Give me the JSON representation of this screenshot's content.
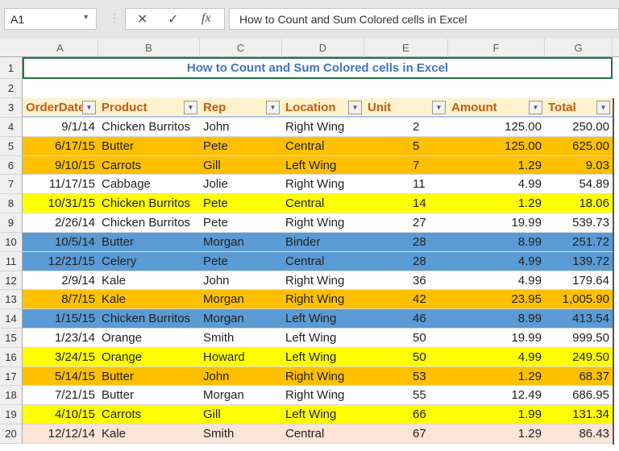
{
  "name_box": "A1",
  "formula_bar": {
    "cancel_icon": "✕",
    "enter_icon": "✓",
    "fx_label": "fx",
    "value": "How to Count and Sum Colored cells in Excel"
  },
  "columns": [
    "A",
    "B",
    "C",
    "D",
    "E",
    "F",
    "G"
  ],
  "title": "How to Count and Sum Colored cells in Excel",
  "headers": [
    "OrderDate",
    "Product",
    "Rep",
    "Location",
    "Unit",
    "Amount",
    "Total"
  ],
  "colors": {
    "orange": "#FFC000",
    "yellow": "#FFFF00",
    "blue": "#5B9BD5",
    "pink": "#FCE4D6",
    "white": "#FFFFFF",
    "header": "#FFF2CC"
  },
  "rows": [
    {
      "n": "4",
      "c": "white",
      "v": [
        "9/1/14",
        "Chicken Burritos",
        "John",
        "Right Wing",
        "2",
        "125.00",
        "250.00"
      ]
    },
    {
      "n": "5",
      "c": "orange",
      "v": [
        "6/17/15",
        "Butter",
        "Pete",
        "Central",
        "5",
        "125.00",
        "625.00"
      ]
    },
    {
      "n": "6",
      "c": "orange",
      "v": [
        "9/10/15",
        "Carrots",
        "Gill",
        "Left Wing",
        "7",
        "1.29",
        "9.03"
      ]
    },
    {
      "n": "7",
      "c": "white",
      "v": [
        "11/17/15",
        "Cabbage",
        "Jolie",
        "Right Wing",
        "11",
        "4.99",
        "54.89"
      ]
    },
    {
      "n": "8",
      "c": "yellow",
      "v": [
        "10/31/15",
        "Chicken Burritos",
        "Pete",
        "Central",
        "14",
        "1.29",
        "18.06"
      ]
    },
    {
      "n": "9",
      "c": "white",
      "v": [
        "2/26/14",
        "Chicken Burritos",
        "Pete",
        "Right Wing",
        "27",
        "19.99",
        "539.73"
      ]
    },
    {
      "n": "10",
      "c": "blue",
      "v": [
        "10/5/14",
        "Butter",
        "Morgan",
        "Binder",
        "28",
        "8.99",
        "251.72"
      ]
    },
    {
      "n": "11",
      "c": "blue",
      "v": [
        "12/21/15",
        "Celery",
        "Pete",
        "Central",
        "28",
        "4.99",
        "139.72"
      ]
    },
    {
      "n": "12",
      "c": "white",
      "v": [
        "2/9/14",
        "Kale",
        "John",
        "Right Wing",
        "36",
        "4.99",
        "179.64"
      ]
    },
    {
      "n": "13",
      "c": "orange",
      "v": [
        "8/7/15",
        "Kale",
        "Morgan",
        "Right Wing",
        "42",
        "23.95",
        "1,005.90"
      ]
    },
    {
      "n": "14",
      "c": "blue",
      "v": [
        "1/15/15",
        "Chicken Burritos",
        "Morgan",
        "Left Wing",
        "46",
        "8.99",
        "413.54"
      ]
    },
    {
      "n": "15",
      "c": "white",
      "v": [
        "1/23/14",
        "Orange",
        "Smith",
        "Left Wing",
        "50",
        "19.99",
        "999.50"
      ]
    },
    {
      "n": "16",
      "c": "yellow",
      "v": [
        "3/24/15",
        "Orange",
        "Howard",
        "Left Wing",
        "50",
        "4.99",
        "249.50"
      ]
    },
    {
      "n": "17",
      "c": "orange",
      "v": [
        "5/14/15",
        "Butter",
        "John",
        "Right Wing",
        "53",
        "1.29",
        "68.37"
      ]
    },
    {
      "n": "18",
      "c": "white",
      "v": [
        "7/21/15",
        "Butter",
        "Morgan",
        "Right Wing",
        "55",
        "12.49",
        "686.95"
      ]
    },
    {
      "n": "19",
      "c": "yellow",
      "v": [
        "4/10/15",
        "Carrots",
        "Gill",
        "Left Wing",
        "66",
        "1.99",
        "131.34"
      ]
    },
    {
      "n": "20",
      "c": "pink",
      "v": [
        "12/12/14",
        "Kale",
        "Smith",
        "Central",
        "67",
        "1.29",
        "86.43"
      ]
    }
  ]
}
